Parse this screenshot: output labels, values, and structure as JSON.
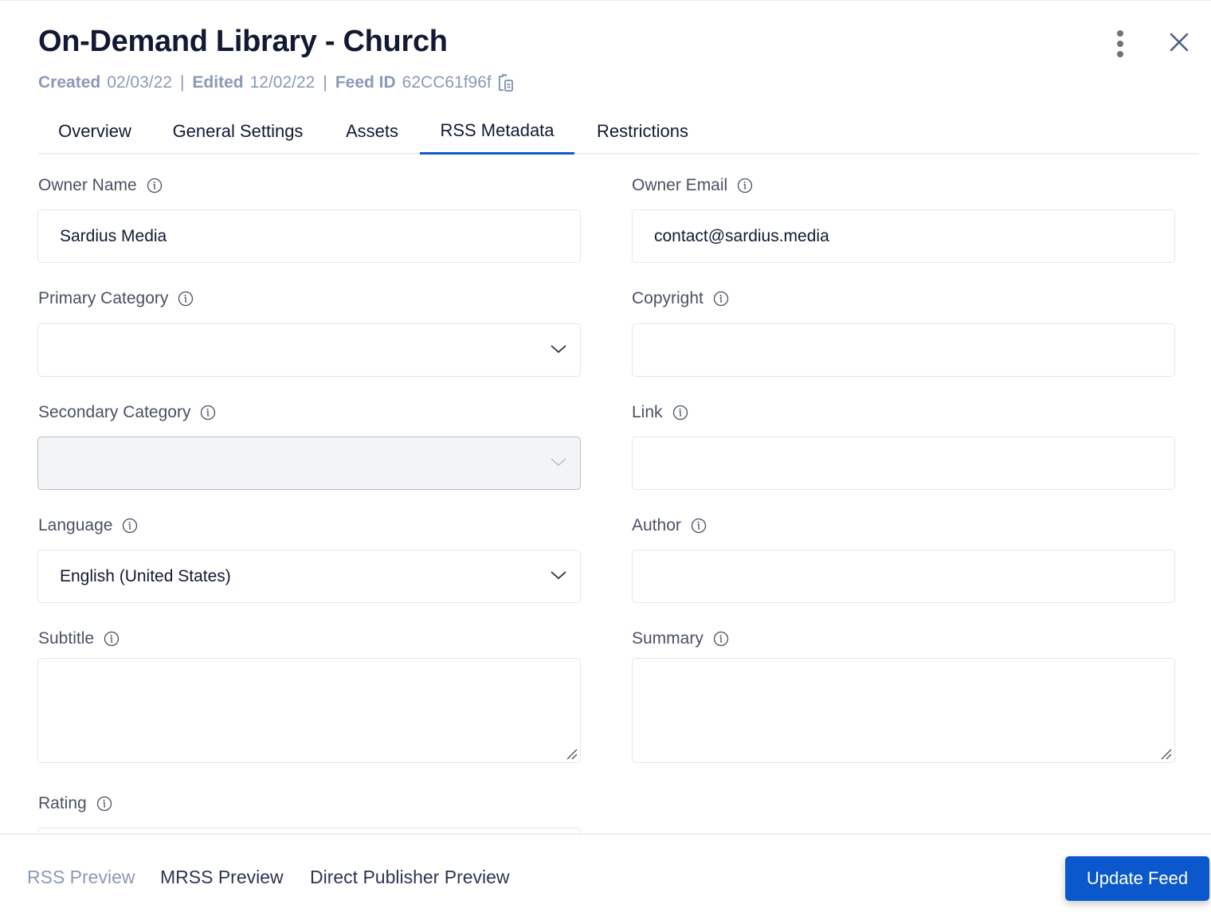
{
  "header": {
    "title": "On-Demand Library - Church",
    "meta": {
      "created_label": "Created",
      "created_value": "02/03/22",
      "edited_label": "Edited",
      "edited_value": "12/02/22",
      "feed_id_label": "Feed ID",
      "feed_id_value": "62CC61f96f",
      "separator": "|"
    },
    "icons": {
      "more": "kebab-menu-icon",
      "close": "close-icon",
      "copy": "clipboard-copy-icon"
    }
  },
  "tabs": [
    {
      "label": "Overview",
      "active": false
    },
    {
      "label": "General Settings",
      "active": false
    },
    {
      "label": "Assets",
      "active": false
    },
    {
      "label": "RSS Metadata",
      "active": true
    },
    {
      "label": "Restrictions",
      "active": false
    }
  ],
  "form": {
    "owner_name": {
      "label": "Owner Name",
      "value": "Sardius Media"
    },
    "owner_email": {
      "label": "Owner Email",
      "value": "contact@sardius.media"
    },
    "primary_category": {
      "label": "Primary Category",
      "value": ""
    },
    "copyright": {
      "label": "Copyright",
      "value": ""
    },
    "secondary_category": {
      "label": "Secondary Category",
      "value": "",
      "disabled": true
    },
    "link": {
      "label": "Link",
      "value": ""
    },
    "language": {
      "label": "Language",
      "value": "English (United States)"
    },
    "author": {
      "label": "Author",
      "value": ""
    },
    "subtitle": {
      "label": "Subtitle",
      "value": ""
    },
    "summary": {
      "label": "Summary",
      "value": ""
    },
    "rating": {
      "label": "Rating",
      "value": ""
    }
  },
  "footer": {
    "rss_preview": "RSS Preview",
    "mrss_preview": "MRSS Preview",
    "direct_publisher_preview": "Direct Publisher Preview",
    "update_button": "Update Feed"
  },
  "colors": {
    "accent": "#0a58cc",
    "title": "#121a33",
    "muted": "#8c98b7",
    "label": "#4a5163"
  }
}
